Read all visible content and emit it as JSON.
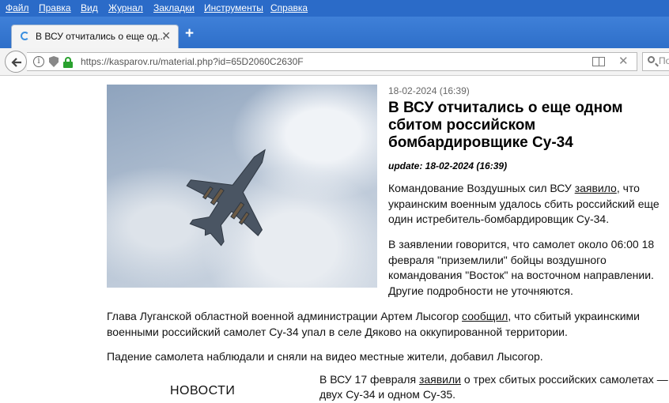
{
  "menu": [
    "Файл",
    "Правка",
    "Вид",
    "Журнал",
    "Закладки",
    "Инструменты",
    "Справка"
  ],
  "tab": {
    "title": "В ВСУ отчитались о еще од...",
    "close": "✕",
    "new": "+"
  },
  "address": {
    "url": "https://kasparov.ru/material.php?id=65D2060C2630F",
    "search_placeholder": "По"
  },
  "article": {
    "date": "18-02-2024 (16:39)",
    "title": "В ВСУ отчитались о еще одном сбитом российском бомбардировщике Су-34",
    "update": "update: 18-02-2024 (16:39)",
    "p1_a": "Командование Воздушных сил ВСУ ",
    "p1_link": "заявило",
    "p1_b": ", что украинским военным удалось сбить российский еще один истребитель-бомбардировщик Су-34.",
    "p2": "В заявлении говорится, что самолет около 06:00 18 февраля \"приземлили\" бойцы воздушного командования \"Восток\" на восточном направлении. Другие подробности не уточняются.",
    "p3_a": "Глава Луганской областной военной администрации Артем Лысогор ",
    "p3_link": "сообщил",
    "p3_b": ", что сбитый украинскими военными российский самолет Су-34 упал в селе Дяково на оккупированной территории.",
    "p4": "Падение самолета наблюдали и сняли на видео местные жители, добавил Лысогор.",
    "p5_a": "В ВСУ 17 февраля ",
    "p5_link": "заявили",
    "p5_b": " о трех сбитых российских самолетах —",
    "p5_c": "двух Су-34 и одном Су-35."
  },
  "sidebar": {
    "news_heading": "НОВОСТИ"
  },
  "colors": {
    "menubar": "#2b6bc8",
    "tabstrip": "#3f80d8",
    "lock": "#2aa12f"
  }
}
